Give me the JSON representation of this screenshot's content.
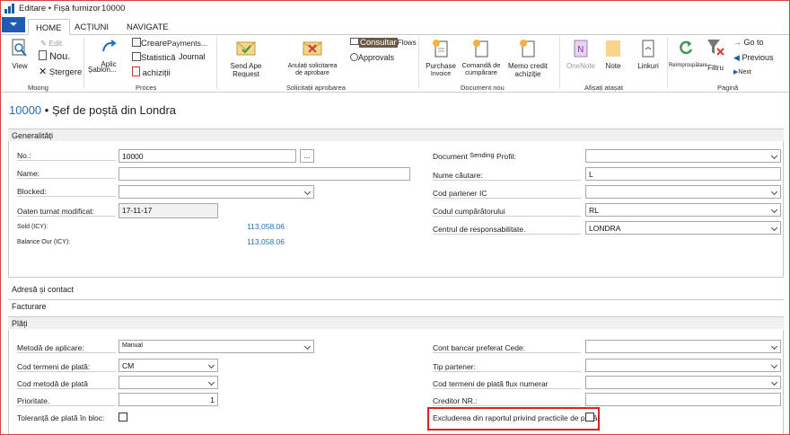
{
  "window": {
    "title": "Editare • Fișă furnizor",
    "record_no": "10000"
  },
  "tabs": [
    {
      "label": "HOME"
    },
    {
      "label": "ACȚIUNI"
    },
    {
      "label": "NAVIGATE"
    }
  ],
  "ribbon": {
    "groups": [
      "Moong",
      "Proces",
      "Solicitații aprobarea",
      "Document nou",
      "Afișați atașat",
      "Pagină"
    ],
    "view": "View",
    "edit": "Edit",
    "new": "Nou.",
    "delete": "Ștergere",
    "apply_template": "Aplic",
    "template": "Șablon...",
    "create_payments": "Creare",
    "payments": "Payments...",
    "statistics": "Statistică",
    "journal": "Journal",
    "purchases": "achiziții",
    "send_approval": "Send Ape",
    "send_approval_2": "Request",
    "cancel_approval": "Anulați solicitarea",
    "cancel_approval_2": "de aprobare",
    "consult": "Consultar",
    "flows": "Flows",
    "approvals": "Approvals",
    "purchase_invoice": "Purchase",
    "purchase_invoice_2": "Invoice",
    "purchase_order": "Comandă de",
    "purchase_order_2": "cumpărare",
    "credit_memo": "Memo credit",
    "credit_memo_2": "achiziție",
    "onenote": "OneNote",
    "notes": "Note",
    "links": "Linkuri",
    "refresh": "Reîmprospătare",
    "filter": "Filtru",
    "goto": "Go to",
    "previous": "Previous",
    "next": "Next"
  },
  "page": {
    "number": "10000",
    "separator": "•",
    "name": "Șef de poștă din Londra"
  },
  "sections": {
    "general": "Generalități",
    "address": "Adresă și contact",
    "invoicing": "Facturare",
    "payments": "Plăți"
  },
  "general": {
    "no_label": "No.:",
    "no_value": "10000",
    "ellipsis": "...",
    "name_label": "Name:",
    "name_value": "",
    "blocked_label": "Blocked:",
    "blocked_value": "",
    "modified_label": "Oaten turnat modificat:",
    "modified_value": "17-11-17",
    "sold_label": "Sold (ICY):",
    "sold_value": "113,058.06",
    "balance_label": "Balance Our (ICY):",
    "balance_value": "113,058.06",
    "doc_sending_label": "Document",
    "doc_sending_label_2": "Sending",
    "doc_sending_label_3": "Profil:",
    "doc_sending_value": "",
    "search_name_label": "Nume căutare:",
    "search_name_value": "L",
    "ic_partner_label": "Cod partener IC",
    "ic_partner_value": "",
    "purchaser_label": "Codul cumpărătorului",
    "purchaser_value": "RL",
    "resp_center_label": "Centrul de responsabilitate.",
    "resp_center_value": "LONDRA"
  },
  "payments": {
    "application_label": "Metodă de aplicare:",
    "application_value": "Manual",
    "terms_label": "Cod termeni de plată:",
    "terms_value": "CM",
    "method_label": "Cod metodă de plată",
    "method_value": "",
    "priority_label": "Prioritate.",
    "priority_value": "1",
    "tolerance_label": "Toleranță de plată în bloc:",
    "bank_label": "Cont bancar preferat Cede:",
    "bank_value": "",
    "partner_type_label": "Tip partener:",
    "partner_type_value": "",
    "flow_terms_label": "Cod termeni de plată flux numerar",
    "flow_terms_value": "",
    "creditor_label": "Creditor NR.:",
    "creditor_value": "",
    "exclude_label": "Excluderea din raportul privind practicile de plată:"
  },
  "colors": {
    "accent": "#1f6fb8",
    "file_button": "#1f5bb5",
    "highlight": "#e02020"
  }
}
